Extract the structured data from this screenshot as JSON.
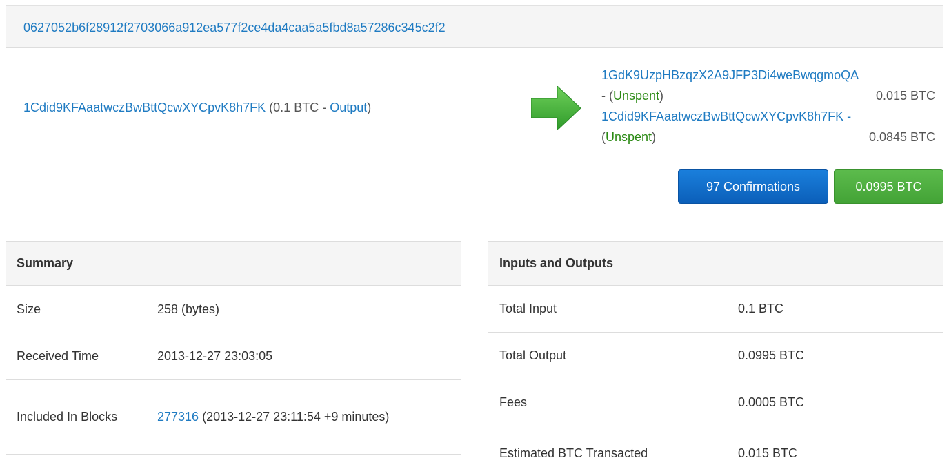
{
  "transaction": {
    "hash": "0627052b6f28912f2703066a912ea577f2ce4da4caa5a5fbd8a57286c345c2f2",
    "input": {
      "address": "1Cdid9KFAaatwczBwBttQcwXYCpvK8h7FK",
      "prefix": "(0.1 BTC - ",
      "link": "Output",
      "suffix": ")"
    },
    "arrow_icon": "green-right-arrow",
    "outputs": [
      {
        "address": "1GdK9UzpHBzqzX2A9JFP3Di4weBwqgmoQA",
        "dash": "- (",
        "status": "Unspent",
        "close": ")",
        "amount": "0.015 BTC"
      },
      {
        "address": "1Cdid9KFAaatwczBwBttQcwXYCpvK8h7FK -",
        "dash": "(",
        "status": "Unspent",
        "close": ")",
        "amount": "0.0845 BTC"
      }
    ],
    "confirmations_label": "97 Confirmations",
    "total_label": "0.0995 BTC",
    "colors": {
      "link": "#1f7bc2",
      "confirm_button": "#0b6fce",
      "total_button": "#4cae3d",
      "unspent": "#2b8a14"
    }
  },
  "summary": {
    "heading": "Summary",
    "size_label": "Size",
    "size_value": "258 (bytes)",
    "received_label": "Received Time",
    "received_value": "2013-12-27 23:03:05",
    "blocks_label": "Included In Blocks",
    "block_link": "277316",
    "block_detail": " (2013-12-27 23:11:54 +9 minutes)"
  },
  "io": {
    "heading": "Inputs and Outputs",
    "rows": [
      {
        "label": "Total Input",
        "value": "0.1 BTC"
      },
      {
        "label": "Total Output",
        "value": "0.0995 BTC"
      },
      {
        "label": "Fees",
        "value": "0.0005 BTC"
      },
      {
        "label": "Estimated BTC Transacted",
        "value": "0.015 BTC"
      }
    ]
  }
}
